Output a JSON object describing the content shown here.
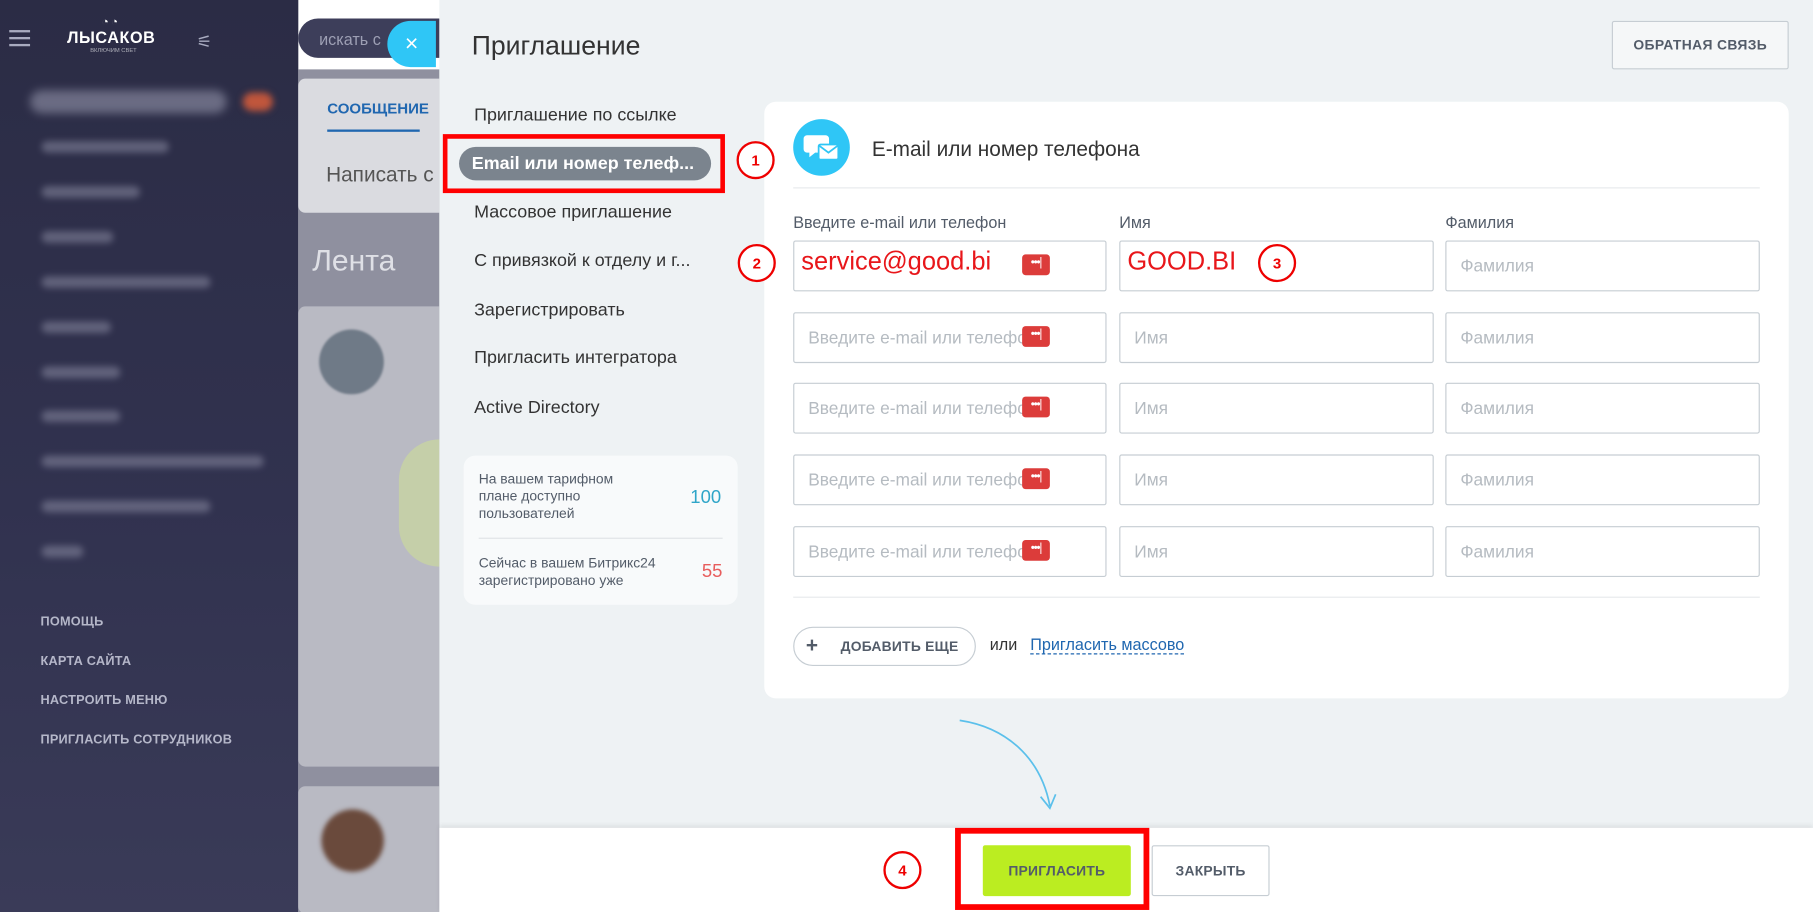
{
  "background": {
    "logo": "ЛЫСАКОВ",
    "logo_sub": "ВКЛЮЧИМ СВЕТ",
    "search_placeholder": "искать с",
    "nav_links": [
      "ПОМОЩЬ",
      "КАРТА САЙТА",
      "НАСТРОИТЬ МЕНЮ",
      "ПРИГЛАСИТЬ СОТРУДНИКОВ"
    ],
    "tab_message": "СООБЩЕНИЕ",
    "write_placeholder": "Написать с",
    "feed_title": "Лента"
  },
  "panel": {
    "title": "Приглашение",
    "feedback_button": "ОБРАТНАЯ СВЯЗЬ",
    "close_glyph": "×",
    "menu": [
      "Приглашение по ссылке",
      "Email или номер телеф...",
      "Массовое приглашение",
      "С привязкой к отделу и г...",
      "Зарегистрировать",
      "Пригласить интегратора",
      "Active Directory"
    ],
    "active_menu_index": 1,
    "tariff": {
      "plan_text": "На вашем тарифном плане доступно пользователей",
      "plan_value": "100",
      "registered_text": "Сейчас в вашем Битрикс24 зарегистрировано уже",
      "registered_value": "55"
    }
  },
  "form": {
    "title": "E-mail или номер телефона",
    "columns": [
      "Введите e-mail или телефон",
      "Имя",
      "Фамилия"
    ],
    "placeholders": {
      "contact": "Введите e-mail или телефон",
      "name": "Имя",
      "surname": "Фамилия"
    },
    "rows": [
      {
        "contact": "service@good.bi",
        "name": "GOOD.BI",
        "surname": ""
      },
      {
        "contact": "",
        "name": "",
        "surname": ""
      },
      {
        "contact": "",
        "name": "",
        "surname": ""
      },
      {
        "contact": "",
        "name": "",
        "surname": ""
      },
      {
        "contact": "",
        "name": "",
        "surname": ""
      }
    ],
    "dots_glyph": "•••|",
    "add_more": "ДОБАВИТЬ ЕЩЕ",
    "or": "или",
    "mass_invite_link": "Пригласить массово"
  },
  "footer": {
    "invite_button": "ПРИГЛАСИТЬ",
    "close_button": "ЗАКРЫТЬ"
  },
  "annotations": {
    "callouts": [
      "1",
      "2",
      "3",
      "4"
    ],
    "color": "#ff0000"
  },
  "colors": {
    "accent": "#2fc6f6",
    "invite_green": "#bbed21",
    "link_blue": "#2067b0",
    "tariff_plan_value": "#2fa5c8",
    "tariff_registered_value": "#e85d5d"
  }
}
